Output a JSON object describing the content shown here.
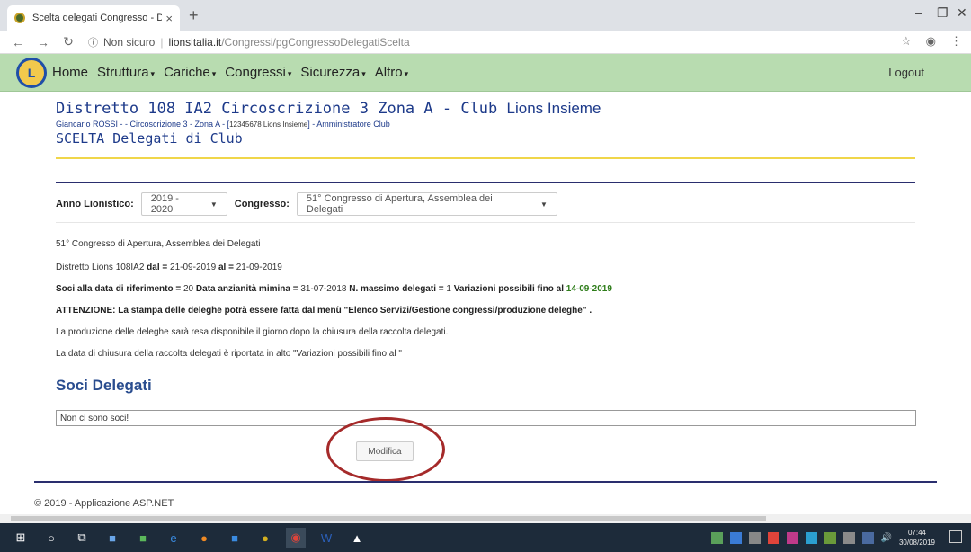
{
  "browser": {
    "tab_title": "Scelta delegati Congresso - Distr",
    "tab_close": "×",
    "new_tab": "+",
    "url_info": "ⓘ",
    "security": "Non sicuro",
    "url_domain": "lionsitalia.it",
    "url_path": "/Congressi/pgCongressoDelegatiScelta"
  },
  "navbar": {
    "logo_text": "L",
    "items": [
      {
        "label": "Home",
        "caret": ""
      },
      {
        "label": "Struttura",
        "caret": "▾"
      },
      {
        "label": "Cariche",
        "caret": "▾"
      },
      {
        "label": "Congressi",
        "caret": "▾"
      },
      {
        "label": "Sicurezza",
        "caret": "▾"
      },
      {
        "label": "Altro",
        "caret": "▾"
      }
    ],
    "logout": "Logout"
  },
  "header": {
    "title": "Distretto 108 IA2 Circoscrizione 3 Zona A - Club",
    "club": "Lions Insieme",
    "sub_user": "Giancarlo ROSSI -",
    "sub_area": " - Circoscrizione 3 - Zona A - [",
    "sub_num": "12345678 Lions Insieme",
    "sub_role": "] - Amministratore Club",
    "scelta": "SCELTA Delegati di Club"
  },
  "filters": {
    "anno_label": "Anno Lionistico:",
    "anno_value": "2019 - 2020",
    "congresso_label": "Congresso:",
    "congresso_value": "51° Congresso di Apertura, Assemblea dei Delegati"
  },
  "info": {
    "line1": "51° Congresso di Apertura, Assemblea dei Delegati",
    "line2_a": "Distretto Lions 108IA2",
    "line2_dal_label": "dal =",
    "line2_dal": "21-09-2019",
    "line2_al_label": "al =",
    "line2_al": "21-09-2019",
    "soci_label": "Soci alla data di riferimento =",
    "soci_value": "20",
    "anz_label": "Data anzianità mimina =",
    "anz_value": "31-07-2018",
    "max_label": "N. massimo delegati =",
    "max_value": "1",
    "var_label": "Variazioni possibili fino al",
    "var_value": "14-09-2019",
    "attenzione": "ATTENZIONE: La stampa delle deleghe potrà essere fatta dal menù \"Elenco Servizi/Gestione congressi/produzione deleghe\" .",
    "line5": "La produzione delle deleghe sarà resa disponibile il giorno dopo la chiusura della raccolta delegati.",
    "line6": "La data di chiusura della raccolta delegati è riportata in alto \"Variazioni possibili fino al \""
  },
  "soci": {
    "title": "Soci Delegati",
    "empty": "Non ci sono soci!"
  },
  "modifica_label": "Modifica",
  "footer": "© 2019 - Applicazione ASP.NET",
  "taskbar": {
    "time": "07:44",
    "date": "30/08/2019"
  }
}
